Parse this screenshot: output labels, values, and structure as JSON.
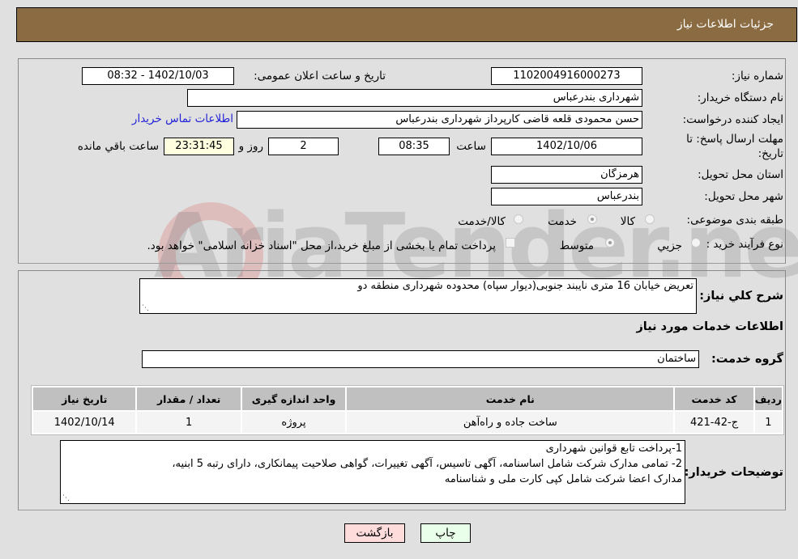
{
  "header": {
    "title": "جزئیات اطلاعات نیاز"
  },
  "fields": {
    "need_number_label": "شماره نیاز:",
    "need_number": "1102004916000273",
    "announce_label": "تاریخ و ساعت اعلان عمومی:",
    "announce_value": "1402/10/03 - 08:32",
    "buyer_org_label": "نام دستگاه خریدار:",
    "buyer_org": "شهرداری بندرعباس",
    "requester_label": "ایجاد کننده درخواست:",
    "requester": "حسن محمودی قلعه قاضی کارپرداز شهرداری بندرعباس",
    "contact_link": "اطلاعات تماس خریدار",
    "deadline_label_1": "مهلت ارسال پاسخ: تا",
    "deadline_label_2": "تاریخ:",
    "deadline_date": "1402/10/06",
    "time_label": "ساعت",
    "deadline_time": "08:35",
    "days": "2",
    "days_label": "روز و",
    "remaining": "23:31:45",
    "remaining_label": "ساعت باقي مانده",
    "province_label": "استان محل تحویل:",
    "province": "هرمزگان",
    "city_label": "شهر محل تحویل:",
    "city": "بندرعباس",
    "category_label": "طبقه بندی موضوعی:",
    "category_options": [
      "کالا",
      "خدمت",
      "کالا/خدمت"
    ],
    "category_selected": "خدمت",
    "process_label": "نوع فرآیند خرید :",
    "process_options": [
      "جزيي",
      "متوسط"
    ],
    "process_selected": "متوسط",
    "treasury_note": "پرداخت تمام یا بخشی از مبلغ خرید،از محل \"اسناد خزانه اسلامی\" خواهد بود."
  },
  "description": {
    "label": "شرح كلي نياز:",
    "value": "تعریض خیابان 16 متری نایبند جنوبی(دیوار سپاه) محدوده شهرداری منطقه دو"
  },
  "services": {
    "section_title": "اطلاعات خدمات مورد نياز",
    "group_label": "گروه خدمت:",
    "group_value": "ساختمان",
    "columns": [
      "ردیف",
      "کد خدمت",
      "نام خدمت",
      "واحد اندازه گیری",
      "تعداد / مقدار",
      "تاریخ نیاز"
    ],
    "rows": [
      [
        "1",
        "ج-42-421",
        "ساخت جاده و راه‌آهن",
        "پروژه",
        "1",
        "1402/10/14"
      ]
    ]
  },
  "buyer_notes": {
    "label": "توضیحات خریدار:",
    "lines": [
      "1-پرداخت تابع قوانین شهرداری",
      "2- تمامی مدارک شرکت شامل اساسنامه، آگهی تاسیس، آگهی تغییرات، گواهی صلاحیت پیمانکاری،  دارای رتبه 5 ابنیه،",
      "مدارک اعضا شرکت شامل کپی کارت ملی و شناسنامه"
    ]
  },
  "buttons": {
    "print": "چاپ",
    "back": "بازگشت"
  },
  "watermark": "AriaTender.neT",
  "colors": {
    "header_bg": "#8b6c42",
    "print_bg": "#eaffea",
    "back_bg": "#ffdcdc",
    "remaining_bg": "#ffffe0",
    "link": "#1f1fd6"
  }
}
